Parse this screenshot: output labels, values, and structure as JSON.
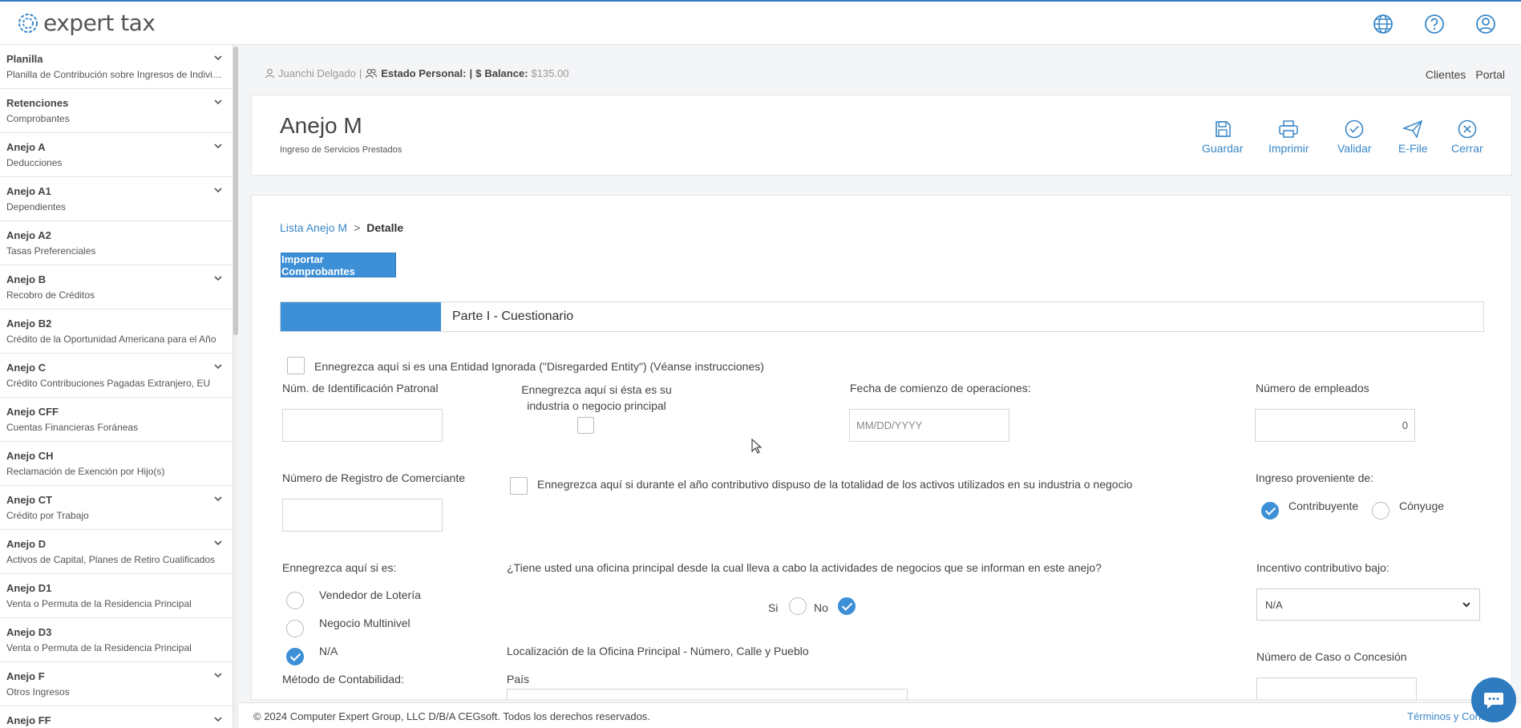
{
  "app": {
    "logo_text": "expert tax"
  },
  "user_bar": {
    "name": "Juanchi Delgado",
    "sep": "|",
    "estado_label": "Estado Personal:",
    "pipe": "|",
    "balance_label": "Balance:",
    "balance_value": "$135.00"
  },
  "top_links": {
    "clientes": "Clientes",
    "portal": "Portal"
  },
  "sidebar": {
    "items": [
      {
        "title": "Planilla",
        "sub": "Planilla de Contribución sobre Ingresos de Individuos",
        "chevron": true
      },
      {
        "title": "Retenciones",
        "sub": "Comprobantes",
        "chevron": true
      },
      {
        "title": "Anejo A",
        "sub": "Deducciones",
        "chevron": true
      },
      {
        "title": "Anejo A1",
        "sub": "Dependientes",
        "chevron": true
      },
      {
        "title": "Anejo A2",
        "sub": "Tasas Preferenciales",
        "chevron": false
      },
      {
        "title": "Anejo B",
        "sub": "Recobro de Créditos",
        "chevron": true
      },
      {
        "title": "Anejo B2",
        "sub": "Crédito de la Oportunidad Americana para el Año",
        "chevron": false
      },
      {
        "title": "Anejo C",
        "sub": "Crédito Contribuciones Pagadas Extranjero, EU",
        "chevron": true
      },
      {
        "title": "Anejo CFF",
        "sub": "Cuentas Financieras Foráneas",
        "chevron": false
      },
      {
        "title": "Anejo CH",
        "sub": "Reclamación de Exención por Hijo(s)",
        "chevron": false
      },
      {
        "title": "Anejo CT",
        "sub": "Crédito por Trabajo",
        "chevron": true
      },
      {
        "title": "Anejo D",
        "sub": "Activos de Capital, Planes de Retiro Cualificados",
        "chevron": true
      },
      {
        "title": "Anejo D1",
        "sub": "Venta o Permuta de la Residencia Principal",
        "chevron": false
      },
      {
        "title": "Anejo D3",
        "sub": "Venta o Permuta de la Residencia Principal",
        "chevron": false
      },
      {
        "title": "Anejo F",
        "sub": "Otros Ingresos",
        "chevron": true
      },
      {
        "title": "Anejo FF",
        "sub": "",
        "chevron": true
      }
    ]
  },
  "header": {
    "title": "Anejo M",
    "subtitle": "Ingreso de Servicios Prestados",
    "actions": {
      "guardar": "Guardar",
      "imprimir": "Imprimir",
      "validar": "Validar",
      "efile": "E-File",
      "cerrar": "Cerrar"
    }
  },
  "breadcrumb": {
    "link": "Lista Anejo M",
    "sep": ">",
    "current": "Detalle"
  },
  "import_button": "Importar Comprobantes",
  "section": {
    "title": "Parte I - Cuestionario"
  },
  "form": {
    "disregarded_label": "Ennegrezca aquí si es una Entidad Ignorada (\"Disregarded Entity\") (Véanse instrucciones)",
    "num_patronal_label": "Núm. de Identificación Patronal",
    "num_patronal_value": "",
    "industria_label_1": "Ennegrezca aquí si ésta es su",
    "industria_label_2": "industria o negocio principal",
    "fecha_label": "Fecha de comienzo de operaciones:",
    "fecha_placeholder": "MM/DD/YYYY",
    "empleados_label": "Número de empleados",
    "empleados_value": "0",
    "registro_label": "Número de Registro de Comerciante",
    "registro_value": "",
    "activos_label": "Ennegrezca aquí si durante el año contributivo dispuso de la totalidad de los activos utilizados en su industria o negocio",
    "ingreso_label": "Ingreso proveniente de:",
    "contribuyente_label": "Contribuyente",
    "conyuge_label": "Cónyuge",
    "ennegrezca_es_label": "Ennegrezca aquí si es:",
    "loteria_label": "Vendedor de Lotería",
    "multinivel_label": "Negocio Multinivel",
    "na_label": "N/A",
    "oficina_question": "¿Tiene usted una oficina principal desde la cual lleva a cabo la actividades de negocios que se informan en este anejo?",
    "si_label": "Si",
    "no_label": "No",
    "incentivo_label": "Incentivo contributivo bajo:",
    "incentivo_value": "N/A",
    "localizacion_label": "Localización de la Oficina Principal - Número, Calle y Pueblo",
    "caso_label": "Número de Caso o Concesión",
    "metodo_label": "Método de Contabilidad:",
    "pais_label": "País"
  },
  "footer": {
    "copyright": "© 2024 Computer Expert Group, LLC D/B/A CEGsoft. Todos los derechos reservados.",
    "terms": "Términos y Condi"
  },
  "colors": {
    "accent": "#3d8fd6",
    "link": "#3a87c8"
  }
}
